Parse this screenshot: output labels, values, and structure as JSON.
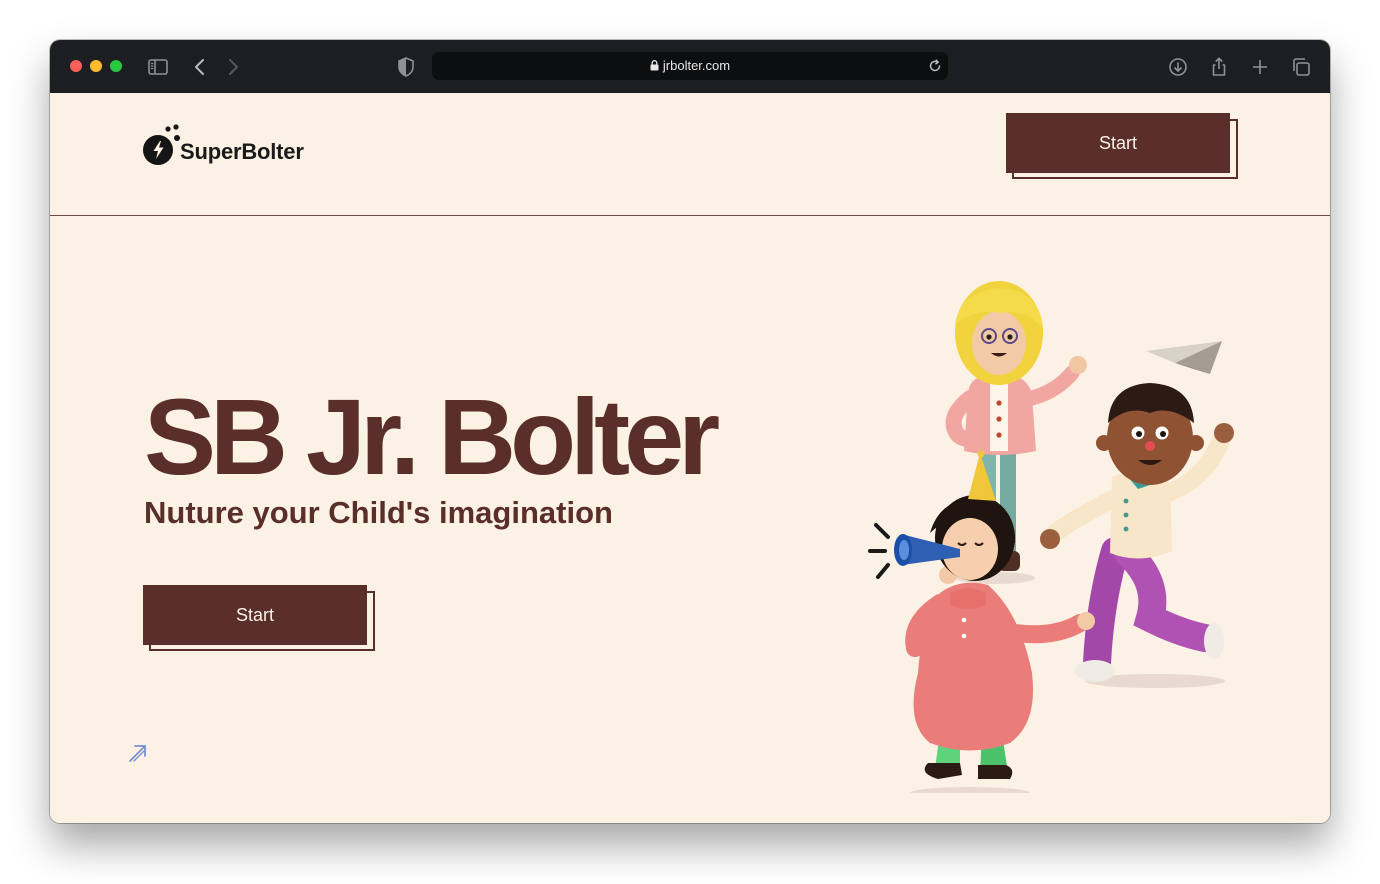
{
  "browser": {
    "url": "jrbolter.com",
    "traffic_lights": [
      "#fe5f57",
      "#febc2e",
      "#28c840"
    ]
  },
  "header": {
    "logo_text": "SuperBolter",
    "start_label": "Start"
  },
  "hero": {
    "title": "SB Jr. Bolter",
    "subtitle": "Nuture your Child's imagination",
    "start_label": "Start"
  },
  "colors": {
    "background": "#fcf1e5",
    "brand_brown": "#5a2e2b",
    "toolbar": "#1c1e21"
  },
  "icons": [
    "sidebar-icon",
    "back-icon",
    "forward-icon",
    "shield-icon",
    "lock-icon",
    "reload-icon",
    "download-icon",
    "share-icon",
    "new-tab-icon",
    "tabs-overview-icon",
    "bolt-icon",
    "arrow-up-right-icon"
  ]
}
